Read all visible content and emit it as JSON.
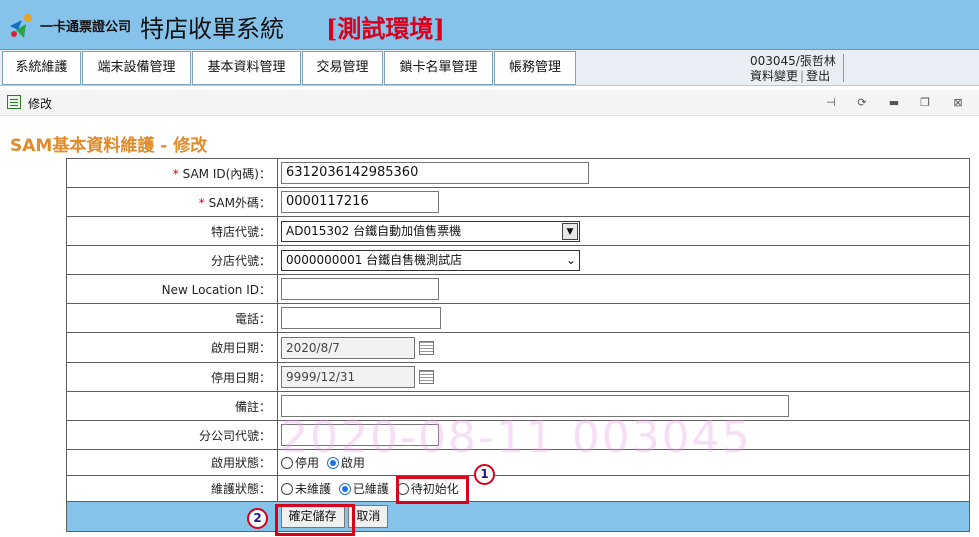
{
  "header": {
    "logo_text": "一卡通票證公司",
    "system_title": "特店收單系統",
    "env_title": "[測試環境]"
  },
  "menu": {
    "items": [
      "系統維護",
      "端末設備管理",
      "基本資料管理",
      "交易管理",
      "鎖卡名單管理",
      "帳務管理"
    ]
  },
  "user": {
    "name": "003045/張哲林",
    "change_data": "資料變更",
    "logout": "登出"
  },
  "panel": {
    "title": "修改"
  },
  "page_title": "SAM基本資料維護 - 修改",
  "form": {
    "sam_id": {
      "label": "SAM ID(內碼)：",
      "value": "6312036142985360"
    },
    "sam_ext": {
      "label": "SAM外碼：",
      "value": "0000117216"
    },
    "store": {
      "label": "特店代號：",
      "value": "AD015302 台鐵自動加值售票機"
    },
    "branch": {
      "label": "分店代號：",
      "value": "0000000001 台鐵自售機測試店"
    },
    "new_location": {
      "label": "New Location ID：",
      "value": ""
    },
    "phone": {
      "label": "電話：",
      "value": ""
    },
    "start_date": {
      "label": "啟用日期：",
      "value": "2020/8/7"
    },
    "end_date": {
      "label": "停用日期：",
      "value": "9999/12/31"
    },
    "note": {
      "label": "備註：",
      "value": ""
    },
    "sub_company": {
      "label": "分公司代號：",
      "value": ""
    },
    "enable_status": {
      "label": "啟用狀態：",
      "options": [
        "停用",
        "啟用"
      ],
      "selected": "啟用"
    },
    "maint_status": {
      "label": "維護狀態：",
      "options": [
        "未維護",
        "已維護",
        "待初始化"
      ],
      "selected": "已維護"
    }
  },
  "buttons": {
    "save": "確定儲存",
    "cancel": "取消"
  },
  "annotations": {
    "badge1": "1",
    "badge2": "2"
  },
  "watermark": "2020-08-11 003045",
  "colors": {
    "header_bg": "#86c3ea",
    "accent_title": "#e08b2c",
    "env_red": "#d9001b",
    "highlight_red": "#d9001b"
  }
}
